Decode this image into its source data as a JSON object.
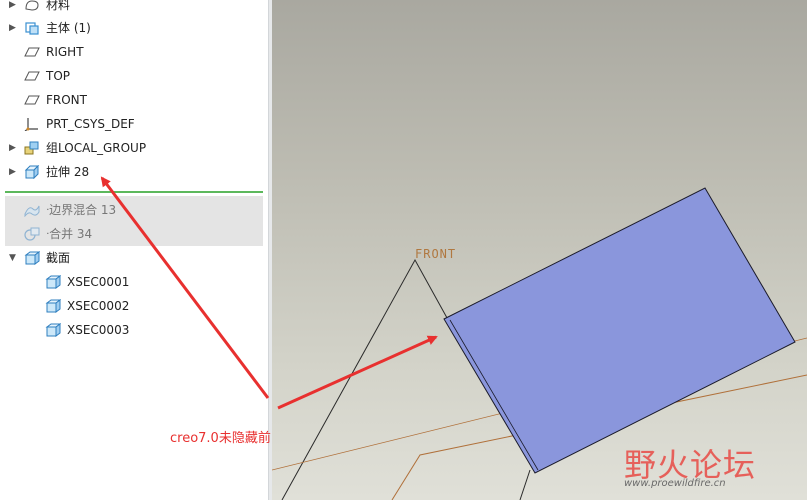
{
  "model_tree": {
    "items": [
      {
        "label": "材料",
        "icon": "material-icon",
        "expandable": true
      },
      {
        "label": "主体 (1)",
        "icon": "body-icon",
        "expandable": true
      },
      {
        "label": "RIGHT",
        "icon": "datum-plane-icon",
        "expandable": false
      },
      {
        "label": "TOP",
        "icon": "datum-plane-icon",
        "expandable": false
      },
      {
        "label": "FRONT",
        "icon": "datum-plane-icon",
        "expandable": false
      },
      {
        "label": "PRT_CSYS_DEF",
        "icon": "coordinate-system-icon",
        "expandable": false
      },
      {
        "label": "组LOCAL_GROUP",
        "icon": "group-icon",
        "expandable": true
      },
      {
        "label": "拉伸 28",
        "icon": "extrude-icon",
        "expandable": true
      },
      {
        "label": "边界混合 13",
        "icon": "boundary-blend-icon",
        "expandable": false,
        "suppressed": true
      },
      {
        "label": "合并 34",
        "icon": "merge-icon",
        "expandable": false,
        "suppressed": true
      },
      {
        "label": "截面",
        "icon": "section-icon",
        "expandable": true,
        "expanded": true
      },
      {
        "label": "XSEC0001",
        "icon": "xsec-icon",
        "expandable": false
      },
      {
        "label": "XSEC0002",
        "icon": "xsec-icon",
        "expandable": false
      },
      {
        "label": "XSEC0003",
        "icon": "xsec-icon",
        "expandable": false
      }
    ]
  },
  "viewport": {
    "datum_label": "FRONT"
  },
  "annotation": {
    "text": "creo7.0未隐藏前",
    "color": "#e8302f"
  },
  "watermark": {
    "text": "野火论坛",
    "url": "www.proewildfire.cn"
  },
  "colors": {
    "surface_fill": "#8a96dc",
    "insert_line": "#5cb85c",
    "datum_orange": "#b07840"
  }
}
